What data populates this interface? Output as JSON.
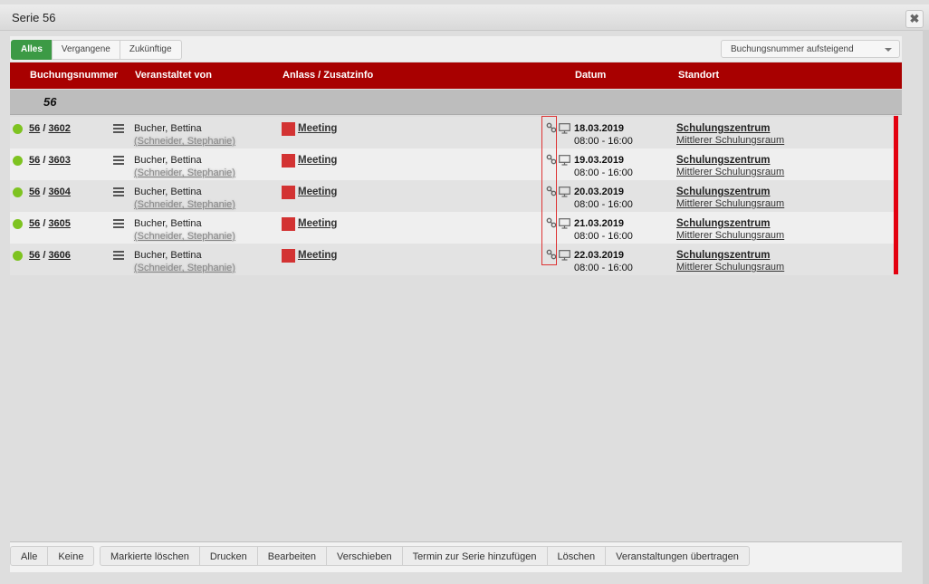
{
  "dialog": {
    "title": "Serie 56",
    "close": "✖"
  },
  "filters": {
    "tabs": [
      "Alles",
      "Vergangene",
      "Zukünftige"
    ],
    "active": "Alles"
  },
  "sort": {
    "selected": "Buchungsnummer aufsteigend"
  },
  "columns": {
    "buchungsnummer": "Buchungsnummer",
    "veranstaltet": "Veranstaltet von",
    "anlass": "Anlass / Zusatzinfo",
    "datum": "Datum",
    "standort": "Standort"
  },
  "group": {
    "label": "56"
  },
  "rows": [
    {
      "series": "56",
      "id": "3602",
      "sep": "/",
      "organizer": "Bucher, Bettina",
      "sub": "(Schneider, Stephanie)",
      "occasion": "Meeting",
      "date": "18.03.2019",
      "time": "08:00 - 16:00",
      "location": "Schulungszentrum",
      "room": "Mittlerer Schulungsraum"
    },
    {
      "series": "56",
      "id": "3603",
      "sep": "/",
      "organizer": "Bucher, Bettina",
      "sub": "(Schneider, Stephanie)",
      "occasion": "Meeting",
      "date": "19.03.2019",
      "time": "08:00 - 16:00",
      "location": "Schulungszentrum",
      "room": "Mittlerer Schulungsraum"
    },
    {
      "series": "56",
      "id": "3604",
      "sep": "/",
      "organizer": "Bucher, Bettina",
      "sub": "(Schneider, Stephanie)",
      "occasion": "Meeting",
      "date": "20.03.2019",
      "time": "08:00 - 16:00",
      "location": "Schulungszentrum",
      "room": "Mittlerer Schulungsraum"
    },
    {
      "series": "56",
      "id": "3605",
      "sep": "/",
      "organizer": "Bucher, Bettina",
      "sub": "(Schneider, Stephanie)",
      "occasion": "Meeting",
      "date": "21.03.2019",
      "time": "08:00 - 16:00",
      "location": "Schulungszentrum",
      "room": "Mittlerer Schulungsraum"
    },
    {
      "series": "56",
      "id": "3606",
      "sep": "/",
      "organizer": "Bucher, Bettina",
      "sub": "(Schneider, Stephanie)",
      "occasion": "Meeting",
      "date": "22.03.2019",
      "time": "08:00 - 16:00",
      "location": "Schulungszentrum",
      "room": "Mittlerer Schulungsraum"
    }
  ],
  "bottom": {
    "select": [
      "Alle",
      "Keine"
    ],
    "actions": [
      "Markierte löschen",
      "Drucken",
      "Bearbeiten",
      "Verschieben",
      "Termin zur Serie hinzufügen",
      "Löschen",
      "Veranstaltungen übertragen"
    ]
  },
  "colors": {
    "header": "#a80000",
    "active_tab": "#3c9a45",
    "status_dot": "#7ec321",
    "event_color": "#d33333",
    "series_bar": "#e3000f"
  },
  "icons": {
    "status": "status-dot-icon",
    "menu": "hamburger-icon",
    "link": "link-icon",
    "monitor": "monitor-icon",
    "close": "close-icon"
  }
}
